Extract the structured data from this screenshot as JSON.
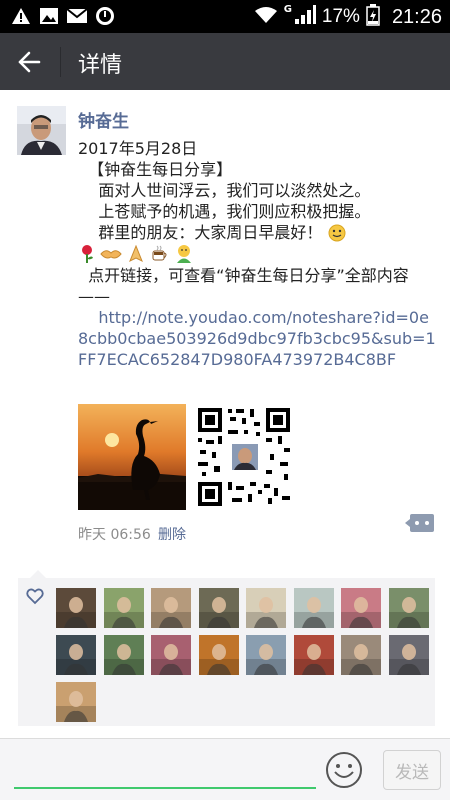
{
  "status_bar": {
    "network": "G",
    "battery_percent": "17%",
    "time": "21:26",
    "icons": [
      "warning-icon",
      "image-icon",
      "mail-icon",
      "sync-icon",
      "wifi-icon",
      "signal-icon",
      "battery-icon"
    ]
  },
  "title_bar": {
    "back_icon": "back-arrow-icon",
    "title": "详情"
  },
  "post": {
    "author": "钟奋生",
    "lines": [
      "2017年5月28日",
      "  【钟奋生每日分享】",
      "    面对人世间浮云，我们可以淡然处之。",
      "    上苍赋予的机遇，我们则应积极把握。",
      "    群里的朋友：大家周日早晨好！"
    ],
    "emojis": [
      "rose-emoji",
      "handshake-emoji",
      "pray-emoji",
      "coffee-emoji",
      "hug-emoji"
    ],
    "link_intro": "  点开链接，可查看“钟奋生每日分享”全部内容——",
    "link": "    http://note.youdao.com/noteshare?id=0e8cbb0cbae503926d9dbc97fb3cbc95&sub=1FF7ECAC652847D980FA473972B4C8BF",
    "images": [
      "crane-sunset-image",
      "qr-code-image"
    ],
    "time": "昨天 06:56",
    "delete_label": "删除",
    "comment_icon": "comment-icon"
  },
  "likes": {
    "icon": "heart-icon",
    "count": 17,
    "colors": [
      "#5c4a3a",
      "#8aa36b",
      "#b59a7c",
      "#6d6a55",
      "#d8cfb8",
      "#b9c7c2",
      "#c97b86",
      "#7a8f6a",
      "#3d4a52",
      "#5f7f55",
      "#a86070",
      "#c0742a",
      "#8a9eb0",
      "#b04a3a",
      "#9a8a7a",
      "#6a6a72",
      "#caa070"
    ]
  },
  "input_bar": {
    "emoji_icon": "smiley-icon",
    "send_label": "发送"
  },
  "colors": {
    "title_bar": "#393a3f",
    "link": "#576b95",
    "input_accent": "#3fc96d"
  }
}
